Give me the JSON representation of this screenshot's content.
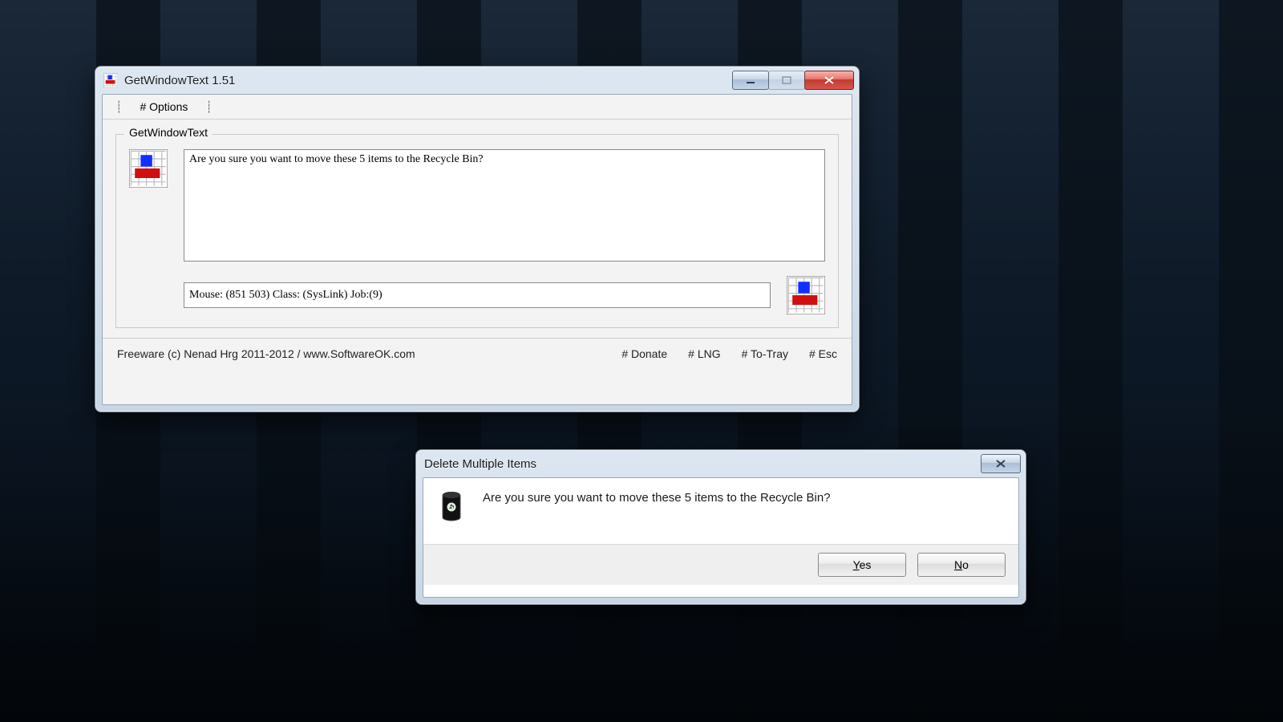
{
  "main_window": {
    "title": "GetWindowText 1.51",
    "menu": {
      "options": "# Options"
    },
    "group_label": "GetWindowText",
    "captured_text": "Are you sure you want to move these 5 items to the Recycle Bin?",
    "status_line": "Mouse: (851 503) Class: (SysLink) Job:(9)",
    "footer": {
      "copyright": "Freeware (c) Nenad Hrg 2011-2012 / www.SoftwareOK.com",
      "donate": "# Donate",
      "lng": "# LNG",
      "to_tray": "# To-Tray",
      "esc": "# Esc"
    }
  },
  "dialog": {
    "title": "Delete Multiple Items",
    "message": "Are you sure you want to move these 5 items to the Recycle Bin?",
    "yes": "Yes",
    "no": "No"
  }
}
